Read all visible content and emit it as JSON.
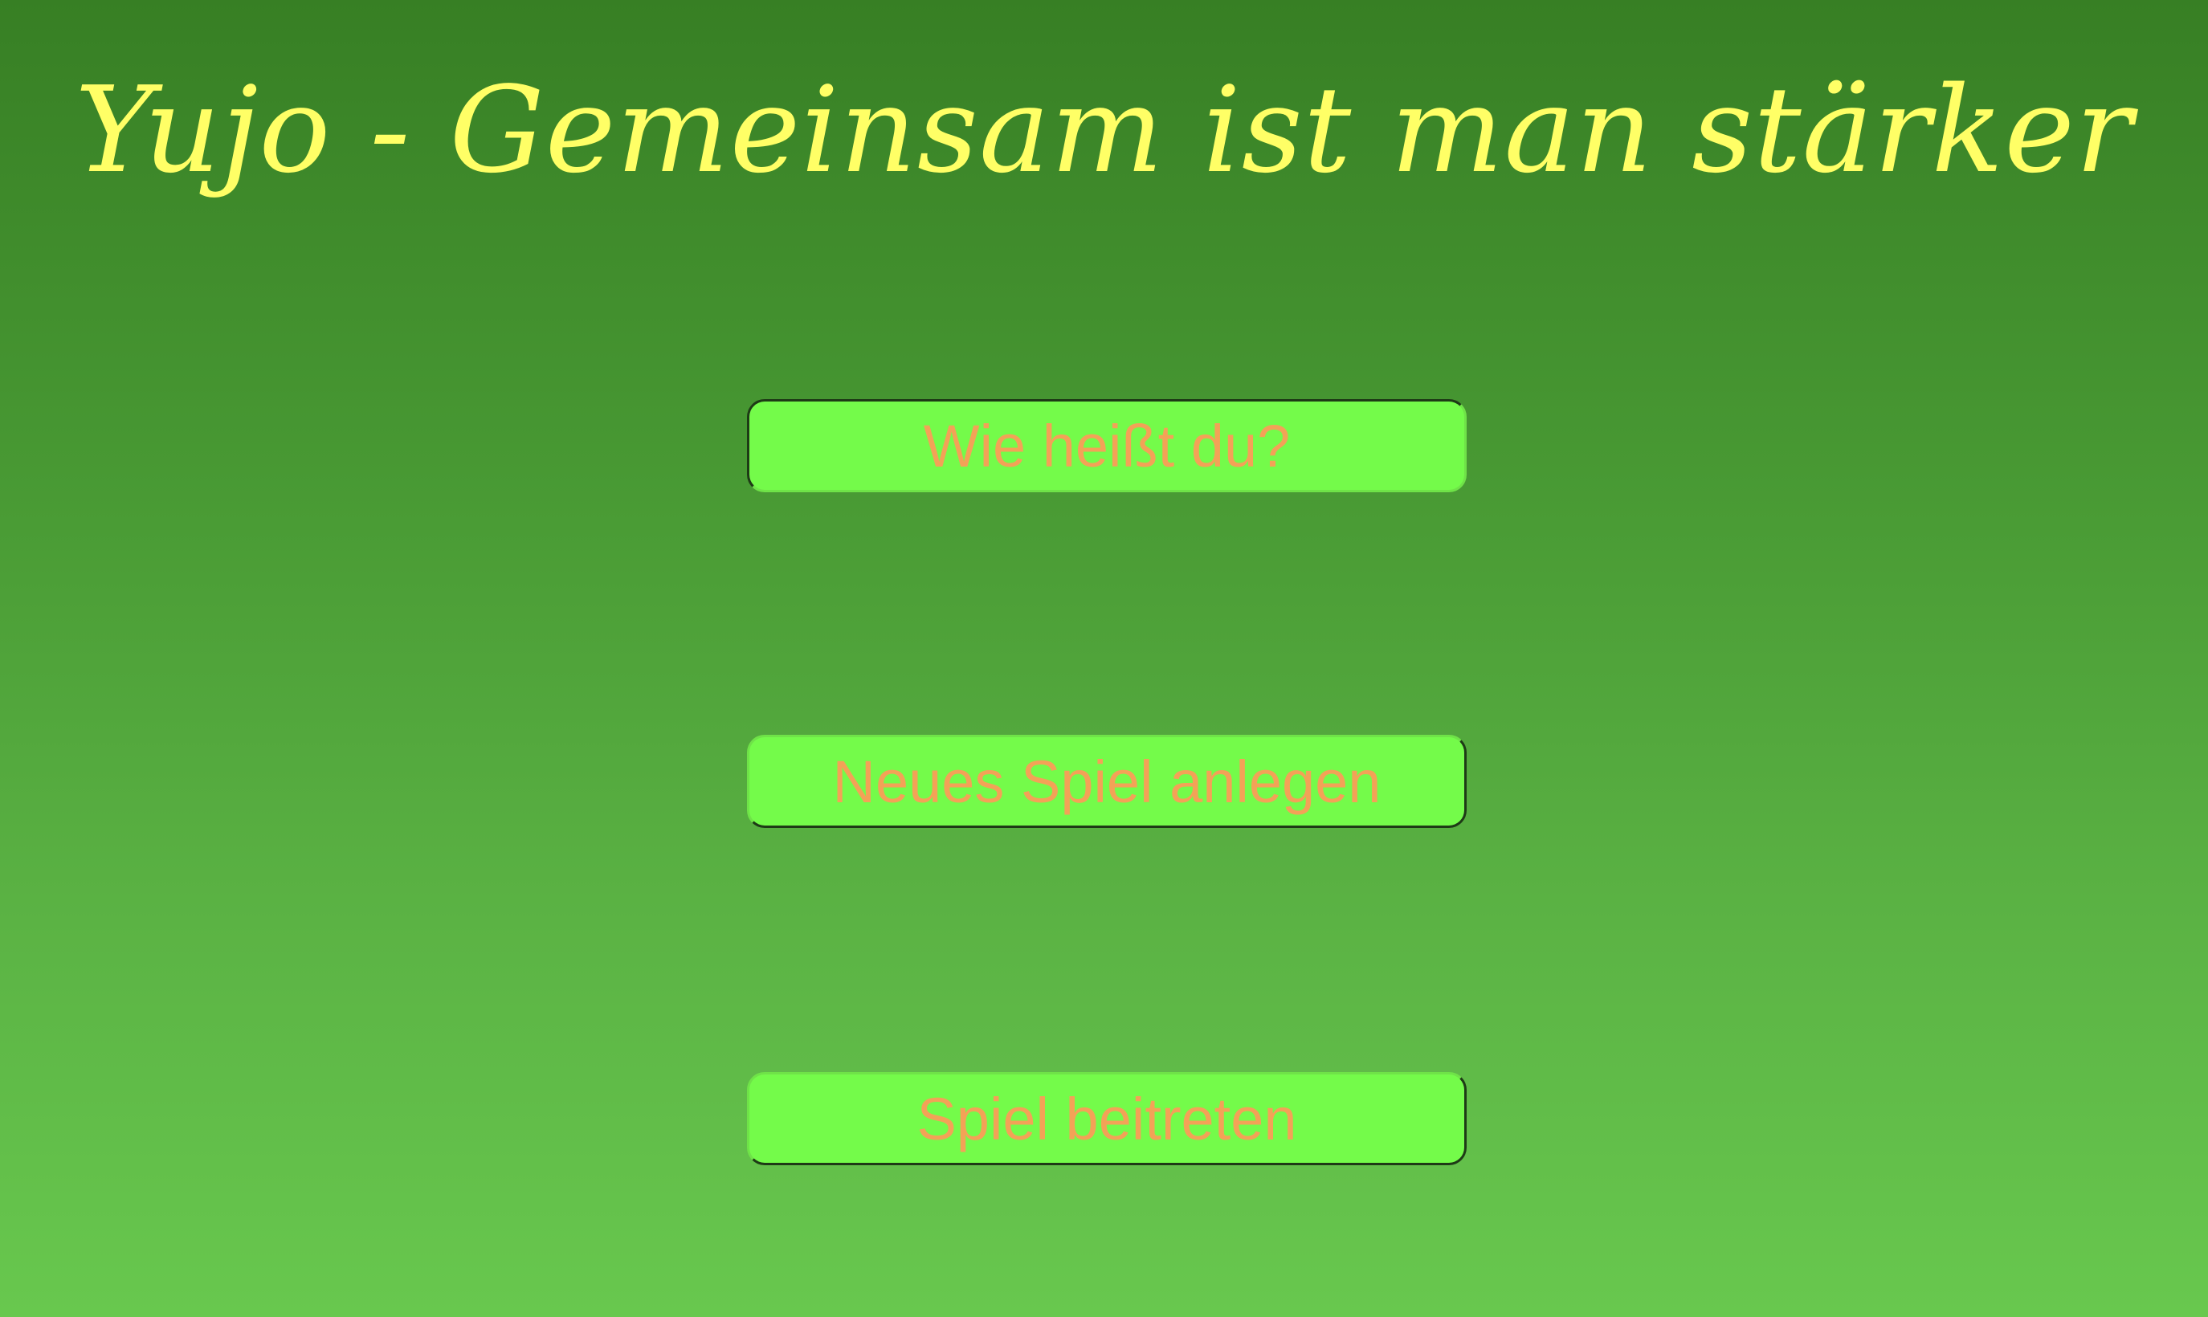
{
  "app": {
    "title": "Yujo - Gemeinsam ist man stärker"
  },
  "form": {
    "name_input_placeholder": "Wie heißt du?",
    "name_input_value": ""
  },
  "actions": {
    "new_game_label": "Neues Spiel anlegen",
    "join_game_label": "Spiel beitreten"
  },
  "colors": {
    "title_text": "#ffff66",
    "button_background": "#74fb4a",
    "button_text": "#f3a257",
    "background_top": "#377f24",
    "background_bottom": "#68c84e"
  }
}
